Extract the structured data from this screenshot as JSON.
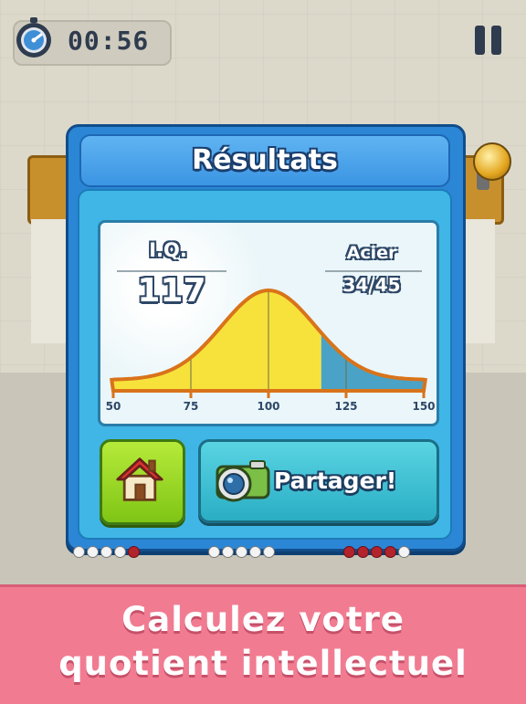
{
  "hud": {
    "timer": "00:56",
    "stopwatch_icon": "stopwatch-icon",
    "pause_icon": "pause-icon"
  },
  "dialog": {
    "title": "Résultats",
    "iq_label": "I.Q.",
    "iq_value": "117",
    "tier": "Acier",
    "rank": "34/45",
    "home_icon": "house-icon",
    "share_icon": "camera-icon",
    "share_label": "Partager!"
  },
  "chart_data": {
    "type": "area",
    "x_ticks": [
      "50",
      "75",
      "100",
      "125",
      "150"
    ],
    "xlim": [
      50,
      150
    ],
    "distribution": "normal",
    "mean": 100,
    "marker": 117,
    "colors": {
      "below": "#f7e23b",
      "above": "#4aa3c6",
      "outline": "#d9731a"
    }
  },
  "dots": {
    "groups": [
      [
        "empty",
        "empty",
        "empty",
        "empty",
        "red"
      ],
      [
        "empty",
        "empty",
        "empty",
        "empty",
        "empty"
      ],
      [
        "red",
        "red",
        "red",
        "red",
        "empty"
      ]
    ]
  },
  "caption": {
    "line1": "Calculez votre",
    "line2": "quotient intellectuel"
  },
  "colors": {
    "banner": "#f17c92",
    "dialog_blue": "#2b86d6",
    "home_green": "#8fd21f",
    "share_cyan": "#3dbdd2"
  }
}
